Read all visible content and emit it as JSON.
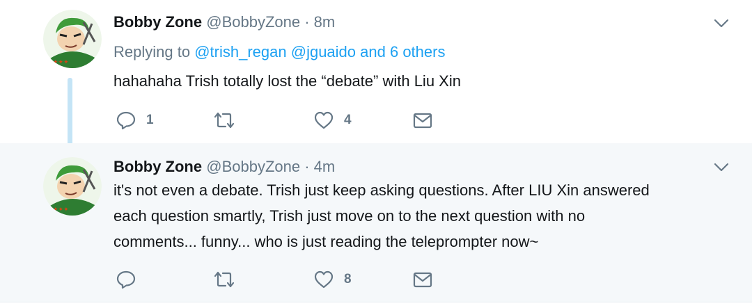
{
  "tweets": [
    {
      "name": "Bobby Zone",
      "handle": "@BobbyZone",
      "separator": "·",
      "time": "8m",
      "replying_prefix": "Replying to",
      "mentions": [
        "@trish_regan",
        "@jguaido"
      ],
      "replying_suffix": "and 6 others",
      "text_lines": [
        "hahahaha Trish totally lost the “debate” with Liu Xin"
      ],
      "reply_count": "1",
      "retweet_count": "",
      "like_count": "4"
    },
    {
      "name": "Bobby Zone",
      "handle": "@BobbyZone",
      "separator": "·",
      "time": "4m",
      "text_lines": [
        "it's not even a debate. Trish just keep asking questions. After LIU Xin answered",
        "each question smartly, Trish just move on to the next question with no",
        "comments... funny... who is just reading the teleprompter now~"
      ],
      "reply_count": "",
      "retweet_count": "",
      "like_count": "8"
    }
  ],
  "colors": {
    "text": "#14171a",
    "secondary": "#657786",
    "link": "#1da1f2",
    "thread_line": "#c4e4f6",
    "selected_bg": "#f5f8fa"
  },
  "icons": [
    "chevron-down-icon",
    "reply-icon",
    "retweet-icon",
    "like-icon",
    "direct-message-icon"
  ]
}
